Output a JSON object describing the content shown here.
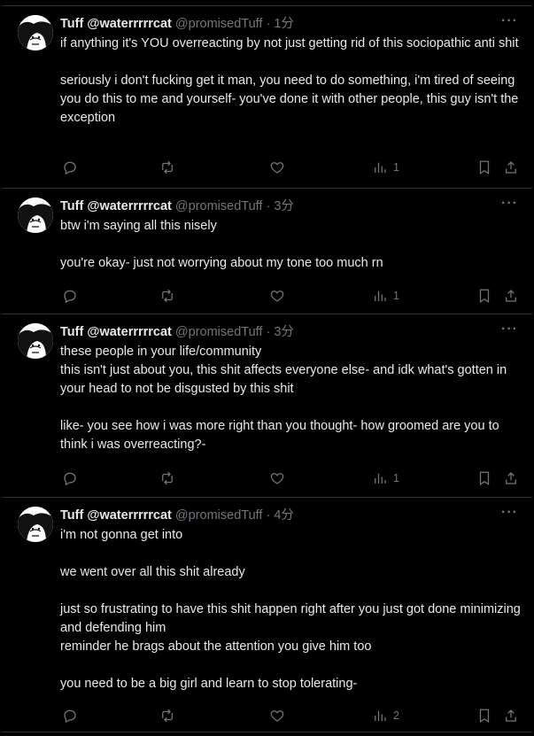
{
  "tweets": [
    {
      "display_name": "Tuff @waterrrrrcat",
      "handle": "@promisedTuff",
      "time": "· 1分",
      "paragraphs": [
        "if anything it's YOU overreacting by not just getting rid of this sociopathic anti shit",
        "",
        "seriously i don't fucking get it man, you need to do something, i'm tired of seeing you do this to me and yourself- you've done it with other people, this guy isn't the exception"
      ],
      "views": "1"
    },
    {
      "display_name": "Tuff @waterrrrrcat",
      "handle": "@promisedTuff",
      "time": "· 3分",
      "paragraphs": [
        "btw i'm saying all this nisely",
        "",
        "you're okay- just not worrying about my tone too much rn"
      ],
      "views": "1"
    },
    {
      "display_name": "Tuff @waterrrrrcat",
      "handle": "@promisedTuff",
      "time": "· 3分",
      "paragraphs": [
        "these people in your life/community",
        "this isn't just about you, this shit affects everyone else- and idk what's gotten in your head to not be disgusted by this shit",
        "",
        "like- you see how i was more right than you thought- how groomed are you to think i was overreacting?-"
      ],
      "views": "1"
    },
    {
      "display_name": "Tuff @waterrrrrcat",
      "handle": "@promisedTuff",
      "time": "· 4分",
      "paragraphs": [
        "i'm not gonna get into",
        "",
        "we went over all this shit already",
        "",
        "just so frustrating to have this shit happen right after you just got done minimizing and defending him",
        "reminder he brags about the attention you give him too",
        "",
        "you need to be a big girl and learn to stop tolerating-"
      ],
      "views": "2"
    }
  ],
  "icons": {
    "more": "more-icon",
    "reply": "reply-icon",
    "retweet": "retweet-icon",
    "like": "like-icon",
    "views": "views-icon",
    "bookmark": "bookmark-icon",
    "share": "share-icon"
  },
  "colors": {
    "background": "#000000",
    "text": "#e7e9ea",
    "muted": "#71767b",
    "divider": "#2f3336"
  }
}
